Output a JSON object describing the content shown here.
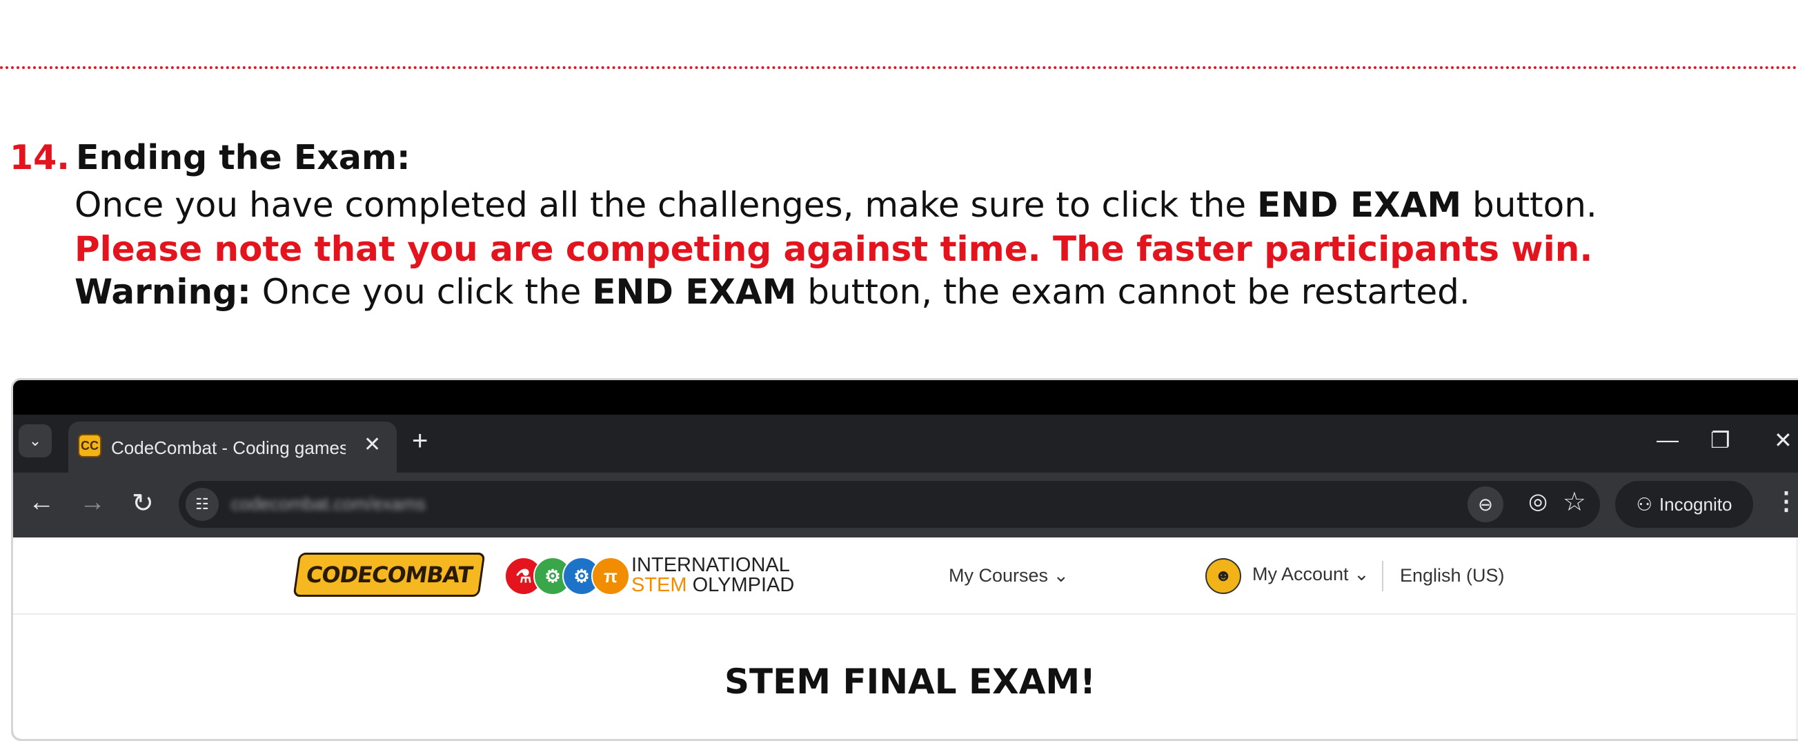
{
  "step": {
    "number": "14.",
    "title": "Ending the Exam:",
    "line1_pre": "Once you have completed all the challenges, make sure to click the ",
    "line1_bold": "END EXAM",
    "line1_post": " button.",
    "line2_red": "Please note that you are competing against time. The faster participants win.",
    "line3_bold_label": "Warning:",
    "line3_pre": " Once you click the ",
    "line3_bold": "END EXAM",
    "line3_post": " button, the exam cannot be restarted."
  },
  "browser": {
    "tab_title": "CodeCombat - Coding games t",
    "tab_favicon": "CC",
    "url": "codecombat.com/exams",
    "incognito_label": "Incognito"
  },
  "site": {
    "logo_text": "CODECOMBAT",
    "olympiad_line1": "INTERNATIONAL",
    "olympiad_stem": "STEM",
    "olympiad_line2_rest": " OLYMPIAD",
    "badges": [
      "⚗",
      "⚙",
      "⚙",
      "π"
    ],
    "nav_my_courses": "My Courses ⌄",
    "nav_my_account": "My Account ⌄",
    "nav_language": "English (US)",
    "heading": "STEM FINAL EXAM!"
  },
  "colors": {
    "accent_red": "#e3141d",
    "tab_dark": "#202124",
    "toolbar": "#35363a"
  }
}
